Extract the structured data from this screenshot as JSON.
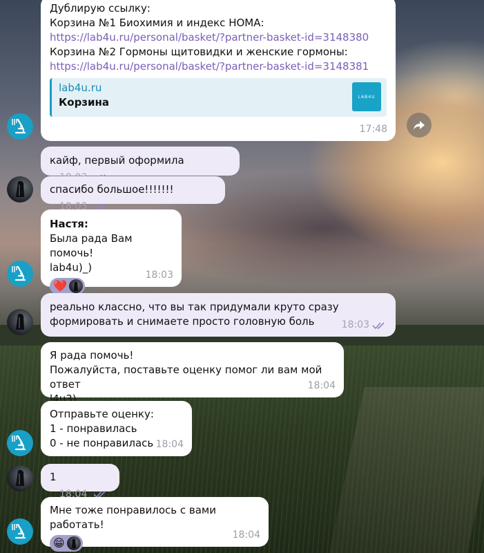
{
  "messages": [
    {
      "lines": [
        "Дублирую ссылку:",
        "Корзина №1 Биохимия и индекс НОМА:"
      ],
      "link1": "https://lab4u.ru/personal/basket/?partner-basket-id=3148380",
      "line3": "Корзина №2 Гормоны щитовидки и женские гормоны:",
      "link2": "https://lab4u.ru/personal/basket/?partner-basket-id=3148381",
      "preview": {
        "site": "lab4u.ru",
        "title": "Корзина",
        "thumb_text": "LAB4U"
      },
      "time": "17:48"
    },
    {
      "text": "кайф, первый оформила",
      "time": "18:03"
    },
    {
      "text": "спасибо большое!!!!!!!",
      "time": "18:03"
    },
    {
      "sender": "Настя:",
      "line1": "Была рада Вам помочь!",
      "line2": " lab4u)_)",
      "reactions": [
        "❤️"
      ],
      "time": "18:03"
    },
    {
      "line1": "реально классно, что вы так придумали круто сразу",
      "line2": "формировать и снимаете просто головную боль",
      "time": "18:03"
    },
    {
      "line1": "Я рада помочь!",
      "line2": "Пожалуйста, поставьте оценку помог ли вам мой ответ",
      "line3": "l4u3)",
      "time": "18:04"
    },
    {
      "line1": "Отправьте оценку:",
      "line2": "1 - понравилась",
      "line3": "0 - не понравилась",
      "time": "18:04"
    },
    {
      "text": "1",
      "time": "18:04"
    },
    {
      "text": "Мне тоже понравилось с вами работать!",
      "reactions": [
        "😁"
      ],
      "time": "18:04"
    }
  ],
  "colors": {
    "accent": "#18a0c6",
    "outgoing_bubble": "#eeeaf8",
    "incoming_bubble": "#ffffff",
    "link": "#7a5fb7",
    "read_ticks": "#8f86c9"
  },
  "icons": {
    "lab_avatar": "microscope-icon",
    "share": "share-arrow-icon",
    "read": "double-check-icon"
  }
}
